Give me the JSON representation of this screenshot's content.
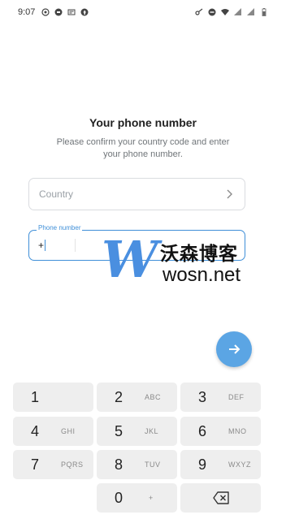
{
  "status_bar": {
    "time": "9:07",
    "left_icons": [
      "whatsapp-icon",
      "message-bubble-icon",
      "notification-icon",
      "facebook-icon"
    ],
    "right_icons": [
      "key-icon",
      "dnd-icon",
      "wifi-icon",
      "signal-icon",
      "signal-icon-2",
      "battery-icon"
    ]
  },
  "header": {
    "title": "Your phone number",
    "subtitle": "Please confirm your country code and enter your phone number."
  },
  "country": {
    "placeholder": "Country"
  },
  "phone": {
    "label": "Phone number",
    "code_value": "+"
  },
  "watermark": {
    "letter": "W",
    "chinese": "沃森博客",
    "site": "wosn.net"
  },
  "fab": {
    "icon": "arrow-right-icon"
  },
  "keypad": {
    "keys": [
      {
        "num": "1",
        "letters": ""
      },
      {
        "num": "2",
        "letters": "ABC"
      },
      {
        "num": "3",
        "letters": "DEF"
      },
      {
        "num": "4",
        "letters": "GHI"
      },
      {
        "num": "5",
        "letters": "JKL"
      },
      {
        "num": "6",
        "letters": "MNO"
      },
      {
        "num": "7",
        "letters": "PQRS"
      },
      {
        "num": "8",
        "letters": "TUV"
      },
      {
        "num": "9",
        "letters": "WXYZ"
      },
      {
        "num": "0",
        "letters": "+"
      }
    ],
    "backspace_icon": "backspace-icon"
  },
  "colors": {
    "accent": "#3f8fd8",
    "fab": "#5ba5e4",
    "key_bg": "#eeeeee",
    "watermark_blue": "#4a8fe0"
  }
}
